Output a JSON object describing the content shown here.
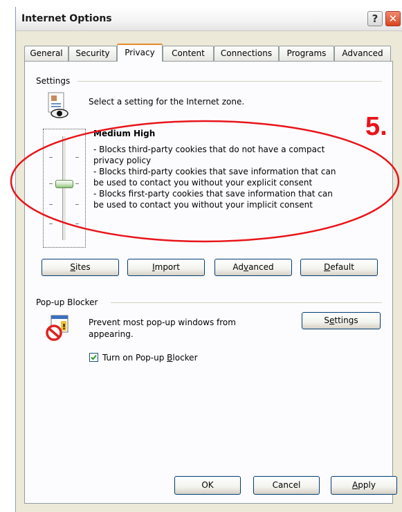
{
  "window": {
    "title": "Internet Options",
    "help_glyph": "?",
    "close_glyph": "✕"
  },
  "tabs": [
    {
      "label": "General",
      "active": false
    },
    {
      "label": "Security",
      "active": false
    },
    {
      "label": "Privacy",
      "active": true
    },
    {
      "label": "Content",
      "active": false
    },
    {
      "label": "Connections",
      "active": false
    },
    {
      "label": "Programs",
      "active": false
    },
    {
      "label": "Advanced",
      "active": false
    }
  ],
  "settings": {
    "group_label": "Settings",
    "zone_prompt": "Select a setting for the Internet zone.",
    "level_title": "Medium High",
    "level_lines": [
      "- Blocks third-party cookies that do not have a compact",
      "privacy policy",
      "- Blocks third-party cookies that save information that can",
      "be used to contact you without your explicit consent",
      "- Blocks first-party cookies that save information that can",
      "be used to contact you without your implicit consent"
    ],
    "buttons": {
      "sites": {
        "label": "Sites",
        "access_key": "S",
        "rest": "ites"
      },
      "import": {
        "label": "Import",
        "access_key": "I",
        "rest": "mport"
      },
      "advanced": {
        "label": "Advanced",
        "pre": "Ad",
        "access_key": "v",
        "rest": "anced"
      },
      "default": {
        "label": "Default",
        "access_key": "D",
        "rest": "efault"
      }
    }
  },
  "popup": {
    "group_label": "Pop-up Blocker",
    "description_line1": "Prevent most pop-up windows from",
    "description_line2": "appearing.",
    "settings_button": {
      "pre": "S",
      "access_key": "e",
      "rest": "ttings"
    },
    "checkbox_checked": true,
    "checkbox_label_pre": "Turn on Pop-up ",
    "checkbox_label_key": "B",
    "checkbox_label_rest": "locker"
  },
  "footer": {
    "ok": "OK",
    "cancel": "Cancel",
    "apply_key": "A",
    "apply_rest": "pply"
  },
  "annotation": {
    "step_label": "5.",
    "color": "#e8141a"
  }
}
